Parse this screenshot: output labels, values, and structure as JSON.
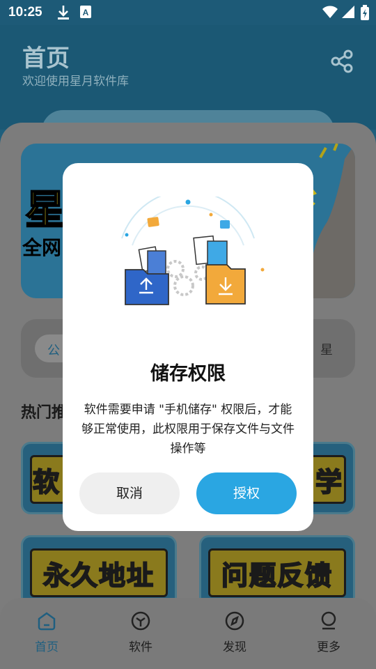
{
  "status_bar": {
    "time": "10:25"
  },
  "header": {
    "title": "首页",
    "subtitle": "欢迎使用星月软件库"
  },
  "banner": {
    "big_text": "星",
    "small_text": "全网"
  },
  "notice": {
    "tag": "公",
    "scroll_text": "力 星"
  },
  "section": {
    "title": "热门推"
  },
  "tiles": [
    {
      "label": "软"
    },
    {
      "label": "学"
    },
    {
      "label": "永久地址"
    },
    {
      "label": "问题反馈"
    }
  ],
  "nav": [
    {
      "label": "首页",
      "icon": "home-icon",
      "active": true
    },
    {
      "label": "软件",
      "icon": "cube-icon",
      "active": false
    },
    {
      "label": "发现",
      "icon": "compass-icon",
      "active": false
    },
    {
      "label": "更多",
      "icon": "user-icon",
      "active": false
    }
  ],
  "dialog": {
    "title": "储存权限",
    "body": "软件需要申请 \"手机储存\" 权限后，才能够正常使用，此权限用于保存文件与文件操作等",
    "cancel_label": "取消",
    "confirm_label": "授权"
  },
  "colors": {
    "accent": "#2aa6e2",
    "header_bg": "#1b5874"
  }
}
